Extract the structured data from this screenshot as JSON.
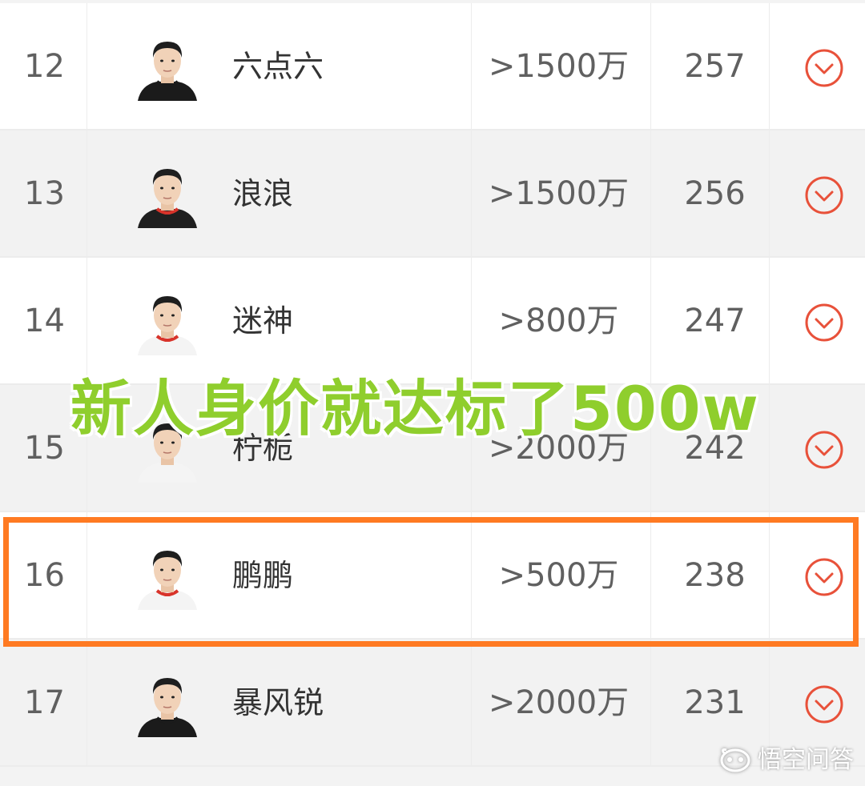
{
  "rows": [
    {
      "rank": "12",
      "name": "六点六",
      "price": ">1500万",
      "score": "257",
      "shirt": "#1b1b1b",
      "trim": "#1b1b1b"
    },
    {
      "rank": "13",
      "name": "浪浪",
      "price": ">1500万",
      "score": "256",
      "shirt": "#1f1f1f",
      "trim": "#d8332a"
    },
    {
      "rank": "14",
      "name": "迷神",
      "price": ">800万",
      "score": "247",
      "shirt": "#f4f4f4",
      "trim": "#d8332a"
    },
    {
      "rank": "15",
      "name": "柠栀",
      "price": ">2000万",
      "score": "242",
      "shirt": "#f4f4f4",
      "trim": "#f4f4f4"
    },
    {
      "rank": "16",
      "name": "鹏鹏",
      "price": ">500万",
      "score": "238",
      "shirt": "#f4f4f4",
      "trim": "#d8332a"
    },
    {
      "rank": "17",
      "name": "暴风锐",
      "price": ">2000万",
      "score": "231",
      "shirt": "#1b1b1b",
      "trim": "#1b1b1b"
    }
  ],
  "overlay_caption": "新人身价就达标了500w",
  "watermark": "悟空问答",
  "colors": {
    "highlight_border": "#ff7a22",
    "expand_icon": "#e8513a",
    "caption": "#8fce2d"
  },
  "icons": {
    "expand": "chevron-down-circle-icon",
    "watermark_logo": "wukong-logo-icon"
  },
  "highlighted_rank": "16"
}
